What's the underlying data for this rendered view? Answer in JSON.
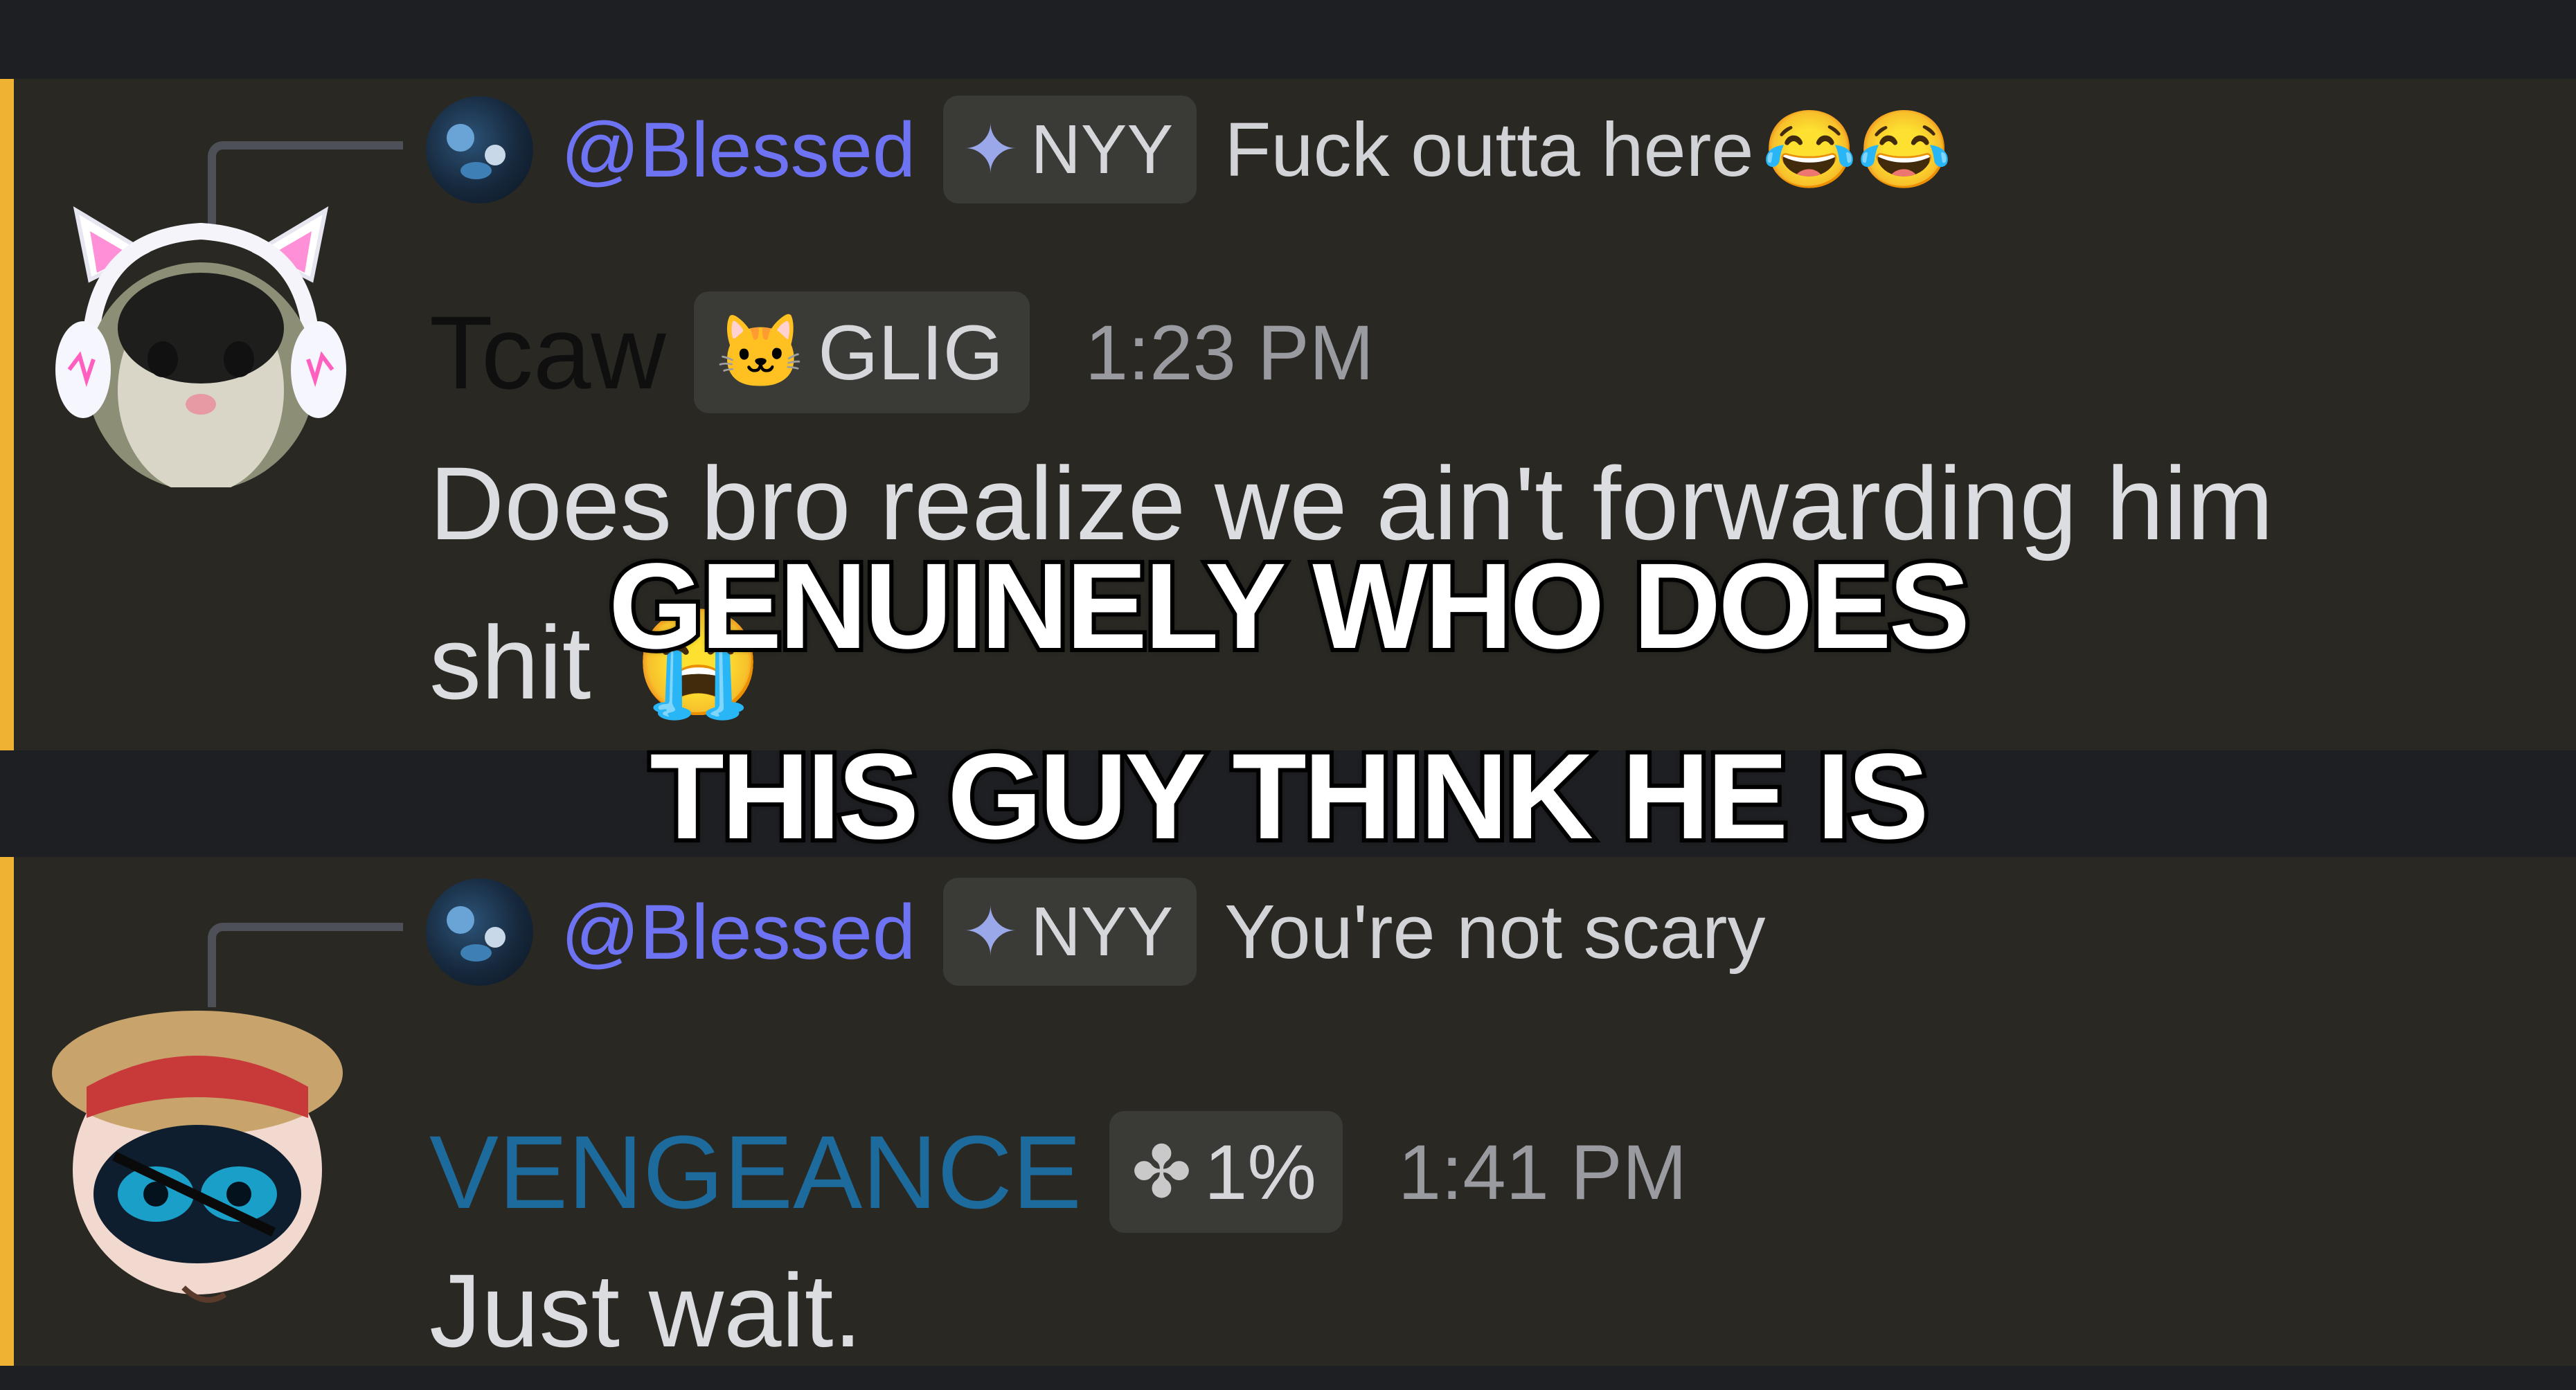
{
  "messages": [
    {
      "reply": {
        "username": "@Blessed",
        "tag": {
          "icon": "sparkle-diamond",
          "label": "NYY"
        },
        "text": "Fuck outta here",
        "emoji": "😂😂"
      },
      "author": {
        "name": "Tcaw",
        "color": "#0f0f0f",
        "avatar": "cat-headphones"
      },
      "tag": {
        "icon": "pink-cat",
        "label": "GLIG"
      },
      "time": "1:23 PM",
      "lines": [
        "Does bro realize we ain't forwarding him",
        "shit"
      ],
      "emoji": "😭"
    },
    {
      "reply": {
        "username": "@Blessed",
        "tag": {
          "icon": "sparkle-diamond",
          "label": "NYY"
        },
        "text": "You're not scary"
      },
      "author": {
        "name": "VENGEANCE",
        "color": "#1d6b9c",
        "avatar": "straw-hat-eyes"
      },
      "tag": {
        "icon": "clover",
        "label": "1%"
      },
      "time": "1:41 PM",
      "lines": [
        "Just wait."
      ]
    }
  ],
  "caption": {
    "line1": "GENUINELY WHO DOES",
    "line2": "THIS GUY THINK HE IS"
  },
  "colors": {
    "mention_bar": "#f0b232",
    "mention_bg": "#2a2823",
    "reply_username": "#6d73f2"
  }
}
